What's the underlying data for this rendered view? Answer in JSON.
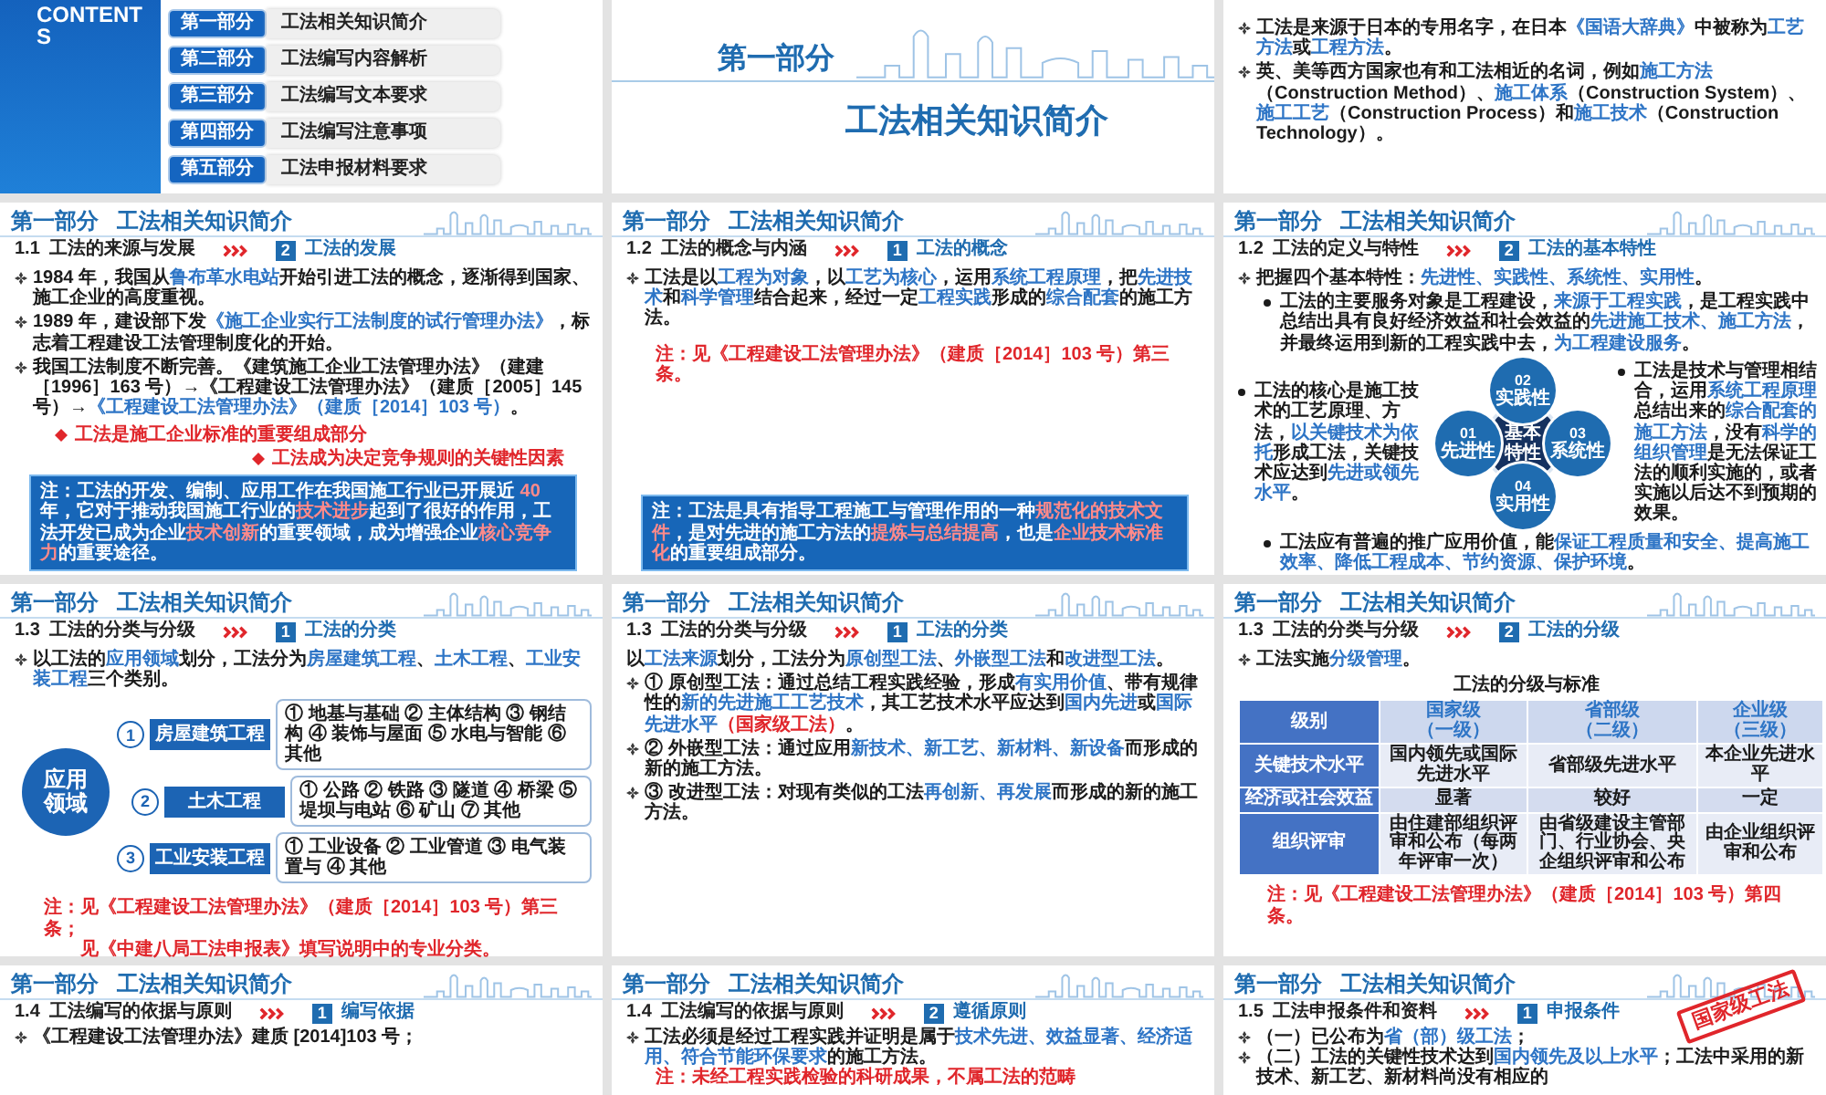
{
  "slides": [
    {
      "kind": "contents",
      "heading": "CONTENTS",
      "items": [
        {
          "part": "第一部分",
          "title": "工法相关知识简介"
        },
        {
          "part": "第二部分",
          "title": "工法编写内容解析"
        },
        {
          "part": "第三部分",
          "title": "工法编写文本要求"
        },
        {
          "part": "第四部分",
          "title": "工法编写注意事项"
        },
        {
          "part": "第五部分",
          "title": "工法申报材料要求"
        }
      ]
    },
    {
      "kind": "cover",
      "part": "第一部分",
      "title": "工法相关知识简介"
    },
    {
      "kind": "content",
      "blocks": [
        {
          "kind": "bullet",
          "runs": [
            {
              "kind": "plain",
              "t": "工法是来源于日本的专用名字，在日本"
            },
            {
              "kind": "accent",
              "t": "《国语大辞典》"
            },
            {
              "kind": "plain",
              "t": "中被称为"
            },
            {
              "kind": "accent",
              "t": "工艺方法"
            },
            {
              "kind": "plain",
              "t": "或"
            },
            {
              "kind": "accent",
              "t": "工程方法"
            },
            {
              "kind": "plain",
              "t": "。"
            }
          ]
        },
        {
          "kind": "bullet",
          "runs": [
            {
              "kind": "plain",
              "t": "英、美等西方国家也有和工法相近的名词，例如"
            },
            {
              "kind": "accent",
              "t": "施工方法"
            },
            {
              "kind": "plain",
              "t": "（Construction Method）、"
            },
            {
              "kind": "accent",
              "t": "施工体系"
            },
            {
              "kind": "plain",
              "t": "（Construction System）、"
            },
            {
              "kind": "accent",
              "t": "施工工艺"
            },
            {
              "kind": "plain",
              "t": "（Construction Process）和"
            },
            {
              "kind": "accent",
              "t": "施工技术"
            },
            {
              "kind": "plain",
              "t": "（Construction Technology）。"
            }
          ]
        }
      ]
    },
    {
      "kind": "content",
      "header": {
        "part": "第一部分",
        "title": "工法相关知识简介"
      },
      "section": {
        "number": "1.1",
        "title": "工法的来源与发展",
        "badge": "2",
        "topic": "工法的发展"
      },
      "blocks": [
        {
          "kind": "bullet",
          "runs": [
            {
              "kind": "plain",
              "t": "1984 年，我国从"
            },
            {
              "kind": "accent",
              "t": "鲁布革水电站"
            },
            {
              "kind": "plain",
              "t": "开始引进工法的概念，逐渐得到国家、施工企业的高度重视。"
            }
          ]
        },
        {
          "kind": "bullet",
          "runs": [
            {
              "kind": "plain",
              "t": "1989 年，建设部下发"
            },
            {
              "kind": "accent",
              "t": "《施工企业实行工法制度的试行管理办法》"
            },
            {
              "kind": "plain",
              "t": "，标志着工程建设工法管理制度化的开始。"
            }
          ]
        },
        {
          "kind": "bullet",
          "runs": [
            {
              "kind": "plain",
              "t": "我国工法制度不断完善。《建筑施工企业工法管理办法》（建建［1996］163 号）→《工程建设工法管理办法》（建质［2005］145 号）→"
            },
            {
              "kind": "accent",
              "t": "《工程建设工法管理办法》（建质［2014］103 号）"
            },
            {
              "kind": "plain",
              "t": "。"
            }
          ]
        },
        {
          "kind": "alerts",
          "items": [
            "工法是施工企业标准的重要组成部分",
            "工法成为决定竞争规则的关键性因素"
          ]
        },
        {
          "kind": "callout",
          "runs": [
            {
              "kind": "plain",
              "t": "注：工法的开发、编制、应用工作在我国施工行业已开展近 "
            },
            {
              "kind": "warn",
              "t": "40"
            },
            {
              "kind": "plain",
              "t": " 年，它对于推动我国施工行业的"
            },
            {
              "kind": "warn",
              "t": "技术进步"
            },
            {
              "kind": "plain",
              "t": "起到了很好的作用，工法开发已成为企业"
            },
            {
              "kind": "warn",
              "t": "技术创新"
            },
            {
              "kind": "plain",
              "t": "的重要领域，成为增强企业"
            },
            {
              "kind": "warn",
              "t": "核心竞争力"
            },
            {
              "kind": "plain",
              "t": "的重要途径。"
            }
          ]
        }
      ]
    },
    {
      "kind": "content",
      "header": {
        "part": "第一部分",
        "title": "工法相关知识简介"
      },
      "section": {
        "number": "1.2",
        "title": "工法的概念与内涵",
        "badge": "1",
        "topic": "工法的概念"
      },
      "blocks": [
        {
          "kind": "bullet",
          "runs": [
            {
              "kind": "plain",
              "t": "工法是以"
            },
            {
              "kind": "accent",
              "t": "工程为对象"
            },
            {
              "kind": "plain",
              "t": "，以"
            },
            {
              "kind": "accent",
              "t": "工艺为核心"
            },
            {
              "kind": "plain",
              "t": "，运用"
            },
            {
              "kind": "accent",
              "t": "系统工程原理"
            },
            {
              "kind": "plain",
              "t": "，把"
            },
            {
              "kind": "accent",
              "t": "先进技术"
            },
            {
              "kind": "plain",
              "t": "和"
            },
            {
              "kind": "accent",
              "t": "科学管理"
            },
            {
              "kind": "plain",
              "t": "结合起来，经过一定"
            },
            {
              "kind": "accent",
              "t": "工程实践"
            },
            {
              "kind": "plain",
              "t": "形成的"
            },
            {
              "kind": "accent",
              "t": "综合配套"
            },
            {
              "kind": "plain",
              "t": "的施工方法。"
            }
          ]
        },
        {
          "kind": "note",
          "lines": [
            "注：见《工程建设工法管理办法》（建质［2014］103 号）第三条。"
          ]
        },
        {
          "kind": "callout",
          "runs": [
            {
              "kind": "plain",
              "t": "注：工法是具有指导工程施工与管理作用的一种"
            },
            {
              "kind": "warn",
              "t": "规范化的技术文件"
            },
            {
              "kind": "plain",
              "t": "，是对先进的施工方法的"
            },
            {
              "kind": "warn",
              "t": "提炼与总结提高"
            },
            {
              "kind": "plain",
              "t": "，也是"
            },
            {
              "kind": "warn",
              "t": "企业技术标准化"
            },
            {
              "kind": "plain",
              "t": "的重要组成部分。"
            }
          ]
        }
      ]
    },
    {
      "kind": "content",
      "header": {
        "part": "第一部分",
        "title": "工法相关知识简介"
      },
      "section": {
        "number": "1.2",
        "title": "工法的定义与特性",
        "badge": "2",
        "topic": "工法的基本特性"
      },
      "blocks": [
        {
          "kind": "bullet",
          "runs": [
            {
              "kind": "plain",
              "t": "把握四个基本特性："
            },
            {
              "kind": "accent",
              "t": "先进性、实践性、系统性、实用性"
            },
            {
              "kind": "plain",
              "t": "。"
            }
          ]
        },
        {
          "kind": "dot",
          "runs": [
            {
              "kind": "plain",
              "t": "工法的主要服务对象是工程建设，"
            },
            {
              "kind": "accent",
              "t": "来源于工程实践"
            },
            {
              "kind": "plain",
              "t": "，是工程实践中总结出具有良好经济效益和社会效益的"
            },
            {
              "kind": "accent",
              "t": "先进施工技术、施工方法"
            },
            {
              "kind": "plain",
              "t": "，并最终运用到新的工程实践中去，"
            },
            {
              "kind": "accent",
              "t": "为工程建设服务"
            },
            {
              "kind": "plain",
              "t": "。"
            }
          ]
        },
        {
          "kind": "features",
          "center": "基本特性",
          "nodes": [
            {
              "number": "01",
              "label": "先进性"
            },
            {
              "number": "02",
              "label": "实践性"
            },
            {
              "number": "03",
              "label": "系统性"
            },
            {
              "number": "04",
              "label": "实用性"
            }
          ],
          "left": [
            {
              "kind": "plain",
              "t": "工法的核心是施工技术的工艺原理、方法，"
            },
            {
              "kind": "accent",
              "t": "以关键技术为依托"
            },
            {
              "kind": "plain",
              "t": "形成工法，关键技术应达到"
            },
            {
              "kind": "accent",
              "t": "先进或领先水平"
            },
            {
              "kind": "plain",
              "t": "。"
            }
          ],
          "right": [
            {
              "kind": "plain",
              "t": "工法是技术与管理相结合，运用"
            },
            {
              "kind": "accent",
              "t": "系统工程原理"
            },
            {
              "kind": "plain",
              "t": "总结出来的"
            },
            {
              "kind": "accent",
              "t": "综合配套的施工方法"
            },
            {
              "kind": "plain",
              "t": "，没有"
            },
            {
              "kind": "accent",
              "t": "科学的组织管理"
            },
            {
              "kind": "plain",
              "t": "是无法保证工法的顺利实施的，或者实施以后达不到预期的效果。"
            }
          ]
        },
        {
          "kind": "dot",
          "runs": [
            {
              "kind": "plain",
              "t": "工法应有普遍的推广应用价值，能"
            },
            {
              "kind": "accent",
              "t": "保证工程质量和安全、提高施工效率、降低工程成本、节约资源、保护环境"
            },
            {
              "kind": "plain",
              "t": "。"
            }
          ]
        }
      ]
    },
    {
      "kind": "content",
      "header": {
        "part": "第一部分",
        "title": "工法相关知识简介"
      },
      "section": {
        "number": "1.3",
        "title": "工法的分类与分级",
        "badge": "1",
        "topic": "工法的分类"
      },
      "blocks": [
        {
          "kind": "bullet",
          "runs": [
            {
              "kind": "plain",
              "t": "以工法的"
            },
            {
              "kind": "accent",
              "t": "应用领域"
            },
            {
              "kind": "plain",
              "t": "划分，工法分为"
            },
            {
              "kind": "accent",
              "t": "房屋建筑工程"
            },
            {
              "kind": "plain",
              "t": "、"
            },
            {
              "kind": "accent",
              "t": "土木工程"
            },
            {
              "kind": "plain",
              "t": "、"
            },
            {
              "kind": "accent",
              "t": "工业安装工程"
            },
            {
              "kind": "plain",
              "t": "三个类别。"
            }
          ]
        },
        {
          "kind": "domains",
          "hub": "应用领域",
          "rows": [
            {
              "number": "1",
              "label": "房屋建筑工程",
              "detail": "① 地基与基础 ② 主体结构 ③ 钢结构 ④ 装饰与屋面 ⑤ 水电与智能 ⑥ 其他"
            },
            {
              "number": "2",
              "label": "土木工程",
              "detail": "① 公路 ② 铁路 ③ 隧道 ④ 桥梁 ⑤ 堤坝与电站 ⑥ 矿山 ⑦ 其他"
            },
            {
              "number": "3",
              "label": "工业安装工程",
              "detail": "① 工业设备 ② 工业管道 ③ 电气装置与 ④ 其他"
            }
          ]
        },
        {
          "kind": "note",
          "lines": [
            "注：见《工程建设工法管理办法》（建质［2014］103 号）第三条；",
            "见《中建八局工法申报表》填写说明中的专业分类。"
          ]
        }
      ]
    },
    {
      "kind": "content",
      "header": {
        "part": "第一部分",
        "title": "工法相关知识简介"
      },
      "section": {
        "number": "1.3",
        "title": "工法的分类与分级",
        "badge": "1",
        "topic": "工法的分类"
      },
      "blocks": [
        {
          "kind": "plain",
          "runs": [
            {
              "kind": "plain",
              "t": "以"
            },
            {
              "kind": "accent",
              "t": "工法来源"
            },
            {
              "kind": "plain",
              "t": "划分，工法分为"
            },
            {
              "kind": "accent",
              "t": "原创型工法"
            },
            {
              "kind": "plain",
              "t": "、"
            },
            {
              "kind": "accent",
              "t": "外嵌型工法"
            },
            {
              "kind": "plain",
              "t": "和"
            },
            {
              "kind": "accent",
              "t": "改进型工法"
            },
            {
              "kind": "plain",
              "t": "。"
            }
          ]
        },
        {
          "kind": "bullet",
          "runs": [
            {
              "kind": "plain",
              "t": "① 原创型工法：通过总结工程实践经验，形成"
            },
            {
              "kind": "accent",
              "t": "有实用价值"
            },
            {
              "kind": "plain",
              "t": "、带有规律性的"
            },
            {
              "kind": "accent",
              "t": "新的先进施工工艺技术"
            },
            {
              "kind": "plain",
              "t": "，其工艺技术水平应达到"
            },
            {
              "kind": "accent",
              "t": "国内先进"
            },
            {
              "kind": "plain",
              "t": "或"
            },
            {
              "kind": "accent",
              "t": "国际先进水平"
            },
            {
              "kind": "warn",
              "t": "（国家级工法）"
            },
            {
              "kind": "plain",
              "t": "。"
            }
          ]
        },
        {
          "kind": "bullet",
          "runs": [
            {
              "kind": "plain",
              "t": "② 外嵌型工法：通过应用"
            },
            {
              "kind": "accent",
              "t": "新技术、新工艺、新材料、新设备"
            },
            {
              "kind": "plain",
              "t": "而形成的新的施工方法。"
            }
          ]
        },
        {
          "kind": "bullet",
          "runs": [
            {
              "kind": "plain",
              "t": "③ 改进型工法：对现有类似的工法"
            },
            {
              "kind": "accent",
              "t": "再创新、再发展"
            },
            {
              "kind": "plain",
              "t": "而形成的新的施工方法。"
            }
          ]
        }
      ]
    },
    {
      "kind": "content",
      "header": {
        "part": "第一部分",
        "title": "工法相关知识简介"
      },
      "section": {
        "number": "1.3",
        "title": "工法的分类与分级",
        "badge": "2",
        "topic": "工法的分级"
      },
      "blocks": [
        {
          "kind": "bullet",
          "runs": [
            {
              "kind": "plain",
              "t": "工法实施"
            },
            {
              "kind": "accent",
              "t": "分级管理"
            },
            {
              "kind": "plain",
              "t": "。"
            }
          ]
        },
        {
          "kind": "table",
          "title": "工法的分级与标准",
          "columns": [
            {
              "name": "级别"
            },
            {
              "name": "国家级",
              "grade": "（一级）"
            },
            {
              "name": "省部级",
              "grade": "（二级）"
            },
            {
              "name": "企业级",
              "grade": "（三级）"
            }
          ],
          "rows": [
            [
              "关键技术水平",
              "国内领先或国际先进水平",
              "省部级先进水平",
              "本企业先进水平"
            ],
            [
              "经济或社会效益",
              "显著",
              "较好",
              "一定"
            ],
            [
              "组织评审",
              "由住建部组织评审和公布（每两年评审一次）",
              "由省级建设主管部门、行业协会、央企组织评审和公布",
              "由企业组织评审和公布"
            ]
          ]
        },
        {
          "kind": "note",
          "lines": [
            "注：见《工程建设工法管理办法》（建质［2014］103 号）第四条。"
          ]
        }
      ]
    },
    {
      "kind": "content",
      "header": {
        "part": "第一部分",
        "title": "工法相关知识简介"
      },
      "section": {
        "number": "1.4",
        "title": "工法编写的依据与原则",
        "badge": "1",
        "topic": "编写依据"
      },
      "blocks": [
        {
          "kind": "bullet",
          "runs": [
            {
              "kind": "plain",
              "t": "《工程建设工法管理办法》建质 [2014]103 号；"
            }
          ]
        }
      ]
    },
    {
      "kind": "content",
      "header": {
        "part": "第一部分",
        "title": "工法相关知识简介"
      },
      "section": {
        "number": "1.4",
        "title": "工法编写的依据与原则",
        "badge": "2",
        "topic": "遵循原则"
      },
      "blocks": [
        {
          "kind": "bullet",
          "runs": [
            {
              "kind": "plain",
              "t": "工法必须是经过工程实践并证明是属于"
            },
            {
              "kind": "accent",
              "t": "技术先进、效益显著、经济适用、符合节能环保要求"
            },
            {
              "kind": "plain",
              "t": "的施工方法。"
            }
          ]
        },
        {
          "kind": "note",
          "lines": [
            "注：未经工程实践检验的科研成果，不属工法的范畴"
          ]
        }
      ]
    },
    {
      "kind": "content",
      "header": {
        "part": "第一部分",
        "title": "工法相关知识简介"
      },
      "section": {
        "number": "1.5",
        "title": "工法申报条件和资料",
        "badge": "1",
        "topic": "申报条件"
      },
      "stamp": "国家级工法",
      "blocks": [
        {
          "kind": "bullet",
          "runs": [
            {
              "kind": "plain",
              "t": "（一）已公布为"
            },
            {
              "kind": "accent",
              "t": "省（部）级工法"
            },
            {
              "kind": "plain",
              "t": "；"
            }
          ]
        },
        {
          "kind": "bullet",
          "runs": [
            {
              "kind": "plain",
              "t": "（二）工法的关键性技术达到"
            },
            {
              "kind": "accent",
              "t": "国内领先及以上水平"
            },
            {
              "kind": "plain",
              "t": "；工法中采用的新技术、新工艺、新材料尚没有相应的"
            }
          ]
        }
      ]
    }
  ]
}
